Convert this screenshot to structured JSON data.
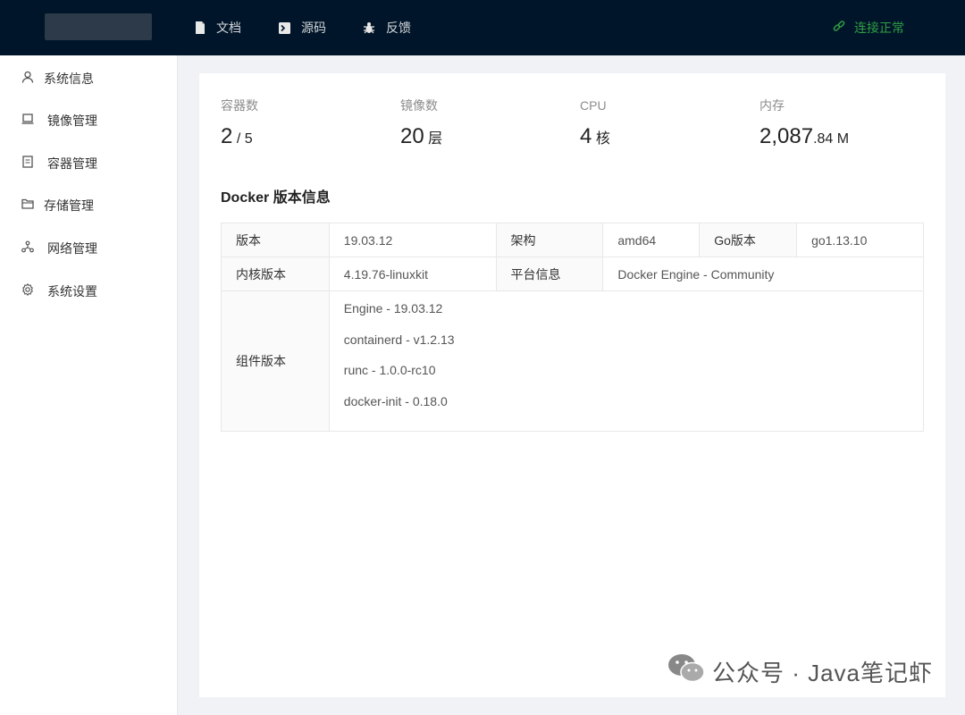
{
  "topbar": {
    "nav": [
      {
        "label": "文档",
        "icon": "document-icon"
      },
      {
        "label": "源码",
        "icon": "terminal-icon"
      },
      {
        "label": "反馈",
        "icon": "bug-icon"
      }
    ],
    "status": {
      "label": "连接正常",
      "icon": "link-icon",
      "color": "#2f9e44"
    }
  },
  "sidebar": {
    "items": [
      {
        "label": "系统信息",
        "icon": "user-icon"
      },
      {
        "label": "镜像管理",
        "icon": "laptop-icon"
      },
      {
        "label": "容器管理",
        "icon": "file-icon"
      },
      {
        "label": "存储管理",
        "icon": "folder-icon"
      },
      {
        "label": "网络管理",
        "icon": "network-icon"
      },
      {
        "label": "系统设置",
        "icon": "gear-icon"
      }
    ]
  },
  "stats": [
    {
      "label": "容器数",
      "value": "2",
      "unit": "/ 5"
    },
    {
      "label": "镜像数",
      "value": "20",
      "unit": "层"
    },
    {
      "label": "CPU",
      "value": "4",
      "unit": "核"
    },
    {
      "label": "内存",
      "value": "2,087",
      "decimal": ".84",
      "unit": "M"
    }
  ],
  "version_section": {
    "title": "Docker 版本信息",
    "version_label": "版本",
    "version": "19.03.12",
    "arch_label": "架构",
    "arch": "amd64",
    "go_label": "Go版本",
    "go": "go1.13.10",
    "kernel_label": "内核版本",
    "kernel": "4.19.76-linuxkit",
    "platform_label": "平台信息",
    "platform": "Docker Engine - Community",
    "components_label": "组件版本",
    "components": [
      "Engine - 19.03.12",
      "containerd - v1.2.13",
      "runc - 1.0.0-rc10",
      "docker-init - 0.18.0"
    ]
  },
  "watermark": {
    "text": "公众号 · Java笔记虾",
    "icon": "wechat-icon"
  }
}
